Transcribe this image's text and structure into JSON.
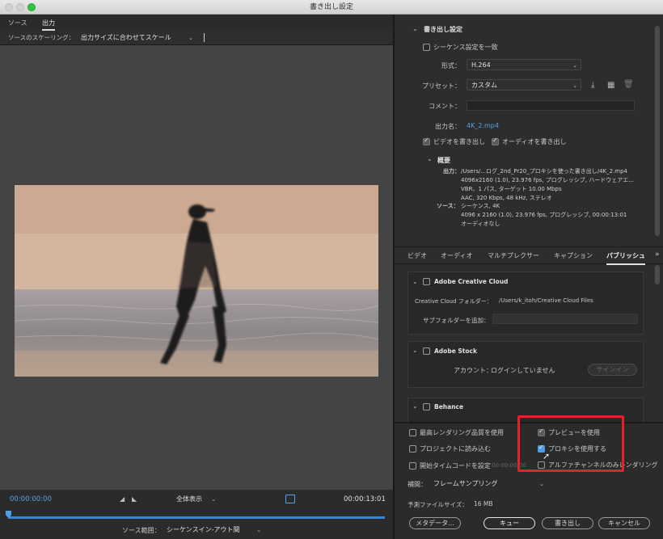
{
  "window": {
    "title": "書き出し設定"
  },
  "left": {
    "tabs": [
      {
        "label": "ソース"
      },
      {
        "label": "出力"
      }
    ],
    "scaling": {
      "label": "ソースのスケーリング：",
      "value": "出力サイズに合わせてスケール"
    },
    "timeline": {
      "current_time": "00:00:00:00",
      "fit_value": "全体表示",
      "end_time": "00:00:13:01",
      "source_range_label": "ソース範囲：",
      "source_range_value": "シーケンスイン-アウト間"
    }
  },
  "export_settings": {
    "header": "書き出し設定",
    "match_sequence": "シーケンス設定を一致",
    "format_label": "形式：",
    "format_value": "H.264",
    "preset_label": "プリセット：",
    "preset_value": "カスタム",
    "comment_label": "コメント：",
    "output_name_label": "出力名：",
    "output_name_value": "4K_2.mp4",
    "export_video": "ビデオを書き出し",
    "export_audio": "オーディオを書き出し",
    "summary_header": "概要",
    "output_label": "出力：",
    "output_lines": [
      "/Users/...ログ_2nd_Pr20_プロキシを使った書き出し/4K_2.mp4",
      "4096x2160 (1.0), 23.976 fps, プログレッシブ, ハードウェアエ...",
      "VBR、1 パス, ターゲット 10.00 Mbps",
      "AAC, 320 Kbps, 48 kHz, ステレオ"
    ],
    "source_label": "ソース：",
    "source_lines": [
      "シーケンス, 4K",
      "4096 x 2160 (1.0), 23.976 fps, プログレッシブ, 00:00:13:01",
      "オーディオなし"
    ]
  },
  "settings_tabs": [
    {
      "label": "ビデオ"
    },
    {
      "label": "オーディオ"
    },
    {
      "label": "マルチプレクサー"
    },
    {
      "label": "キャプション"
    },
    {
      "label": "パブリッシュ"
    }
  ],
  "publish": {
    "cc": {
      "title": "Adobe Creative Cloud",
      "folder_label": "Creative Cloud フォルダー：",
      "folder_value": "/Users/k_itoh/Creative Cloud Files",
      "subfolder_label": "サブフォルダーを追加："
    },
    "stock": {
      "title": "Adobe Stock",
      "account_label": "アカウント：",
      "account_value": "ログインしていません",
      "signin": "サインイン"
    },
    "behance": {
      "title": "Behance"
    }
  },
  "bottom": {
    "max_render": "最高レンダリング品質を使用",
    "use_preview": "プレビューを使用",
    "import_project": "プロジェクトに読み込む",
    "use_proxy": "プロキシを使用する",
    "start_timecode": "開始タイムコードを設定",
    "start_timecode_value": "00:00:00:00",
    "alpha_only": "アルファチャンネルのみレンダリング",
    "interp_label": "補間：",
    "interp_value": "フレームサンプリング",
    "filesize_label": "予測ファイルサイズ：",
    "filesize_value": "16 MB",
    "metadata_btn": "メタデータ...",
    "queue_btn": "キュー",
    "export_btn": "書き出し",
    "cancel_btn": "キャンセル"
  },
  "colors": {
    "accent_blue": "#4c9fe7",
    "highlight_red": "#e8202a"
  }
}
